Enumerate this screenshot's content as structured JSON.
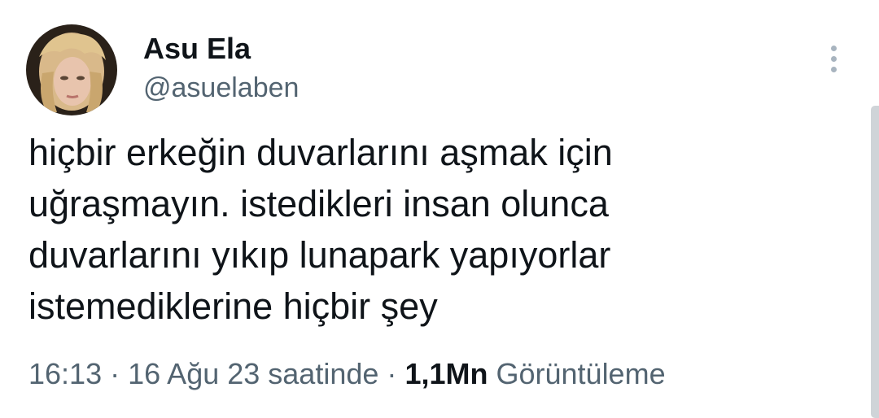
{
  "author": {
    "name": "Asu Ela",
    "handle": "@asuelaben"
  },
  "tweet": {
    "lines": [
      "hiçbir erkeğin duvarlarını aşmak için",
      "uğraşmayın. istedikleri insan olunca",
      "duvarlarını yıkıp lunapark yapıyorlar",
      "istemediklerine hiçbir şey"
    ]
  },
  "meta": {
    "time": "16:13",
    "separator1": "·",
    "date": "16 Ağu 23 saatinde",
    "separator2": "·",
    "views_count": "1,1Mn",
    "views_label": "Görüntüleme"
  },
  "icons": {
    "more": "more-vertical-icon"
  },
  "colors": {
    "text_primary": "#0f1419",
    "text_secondary": "#536471",
    "icon_gray": "#a8b4bf"
  }
}
